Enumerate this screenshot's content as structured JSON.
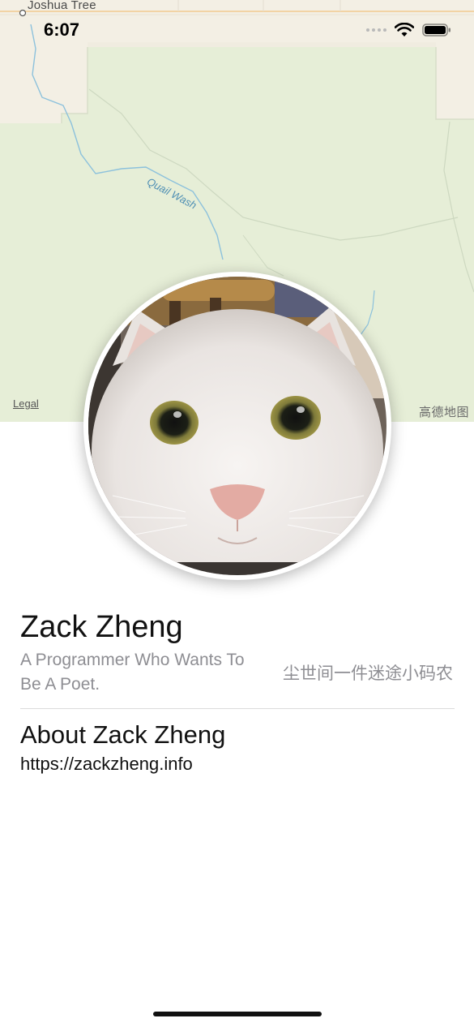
{
  "status_bar": {
    "time": "6:07",
    "icons": [
      "signal-dots-icon",
      "wifi-icon",
      "battery-icon"
    ]
  },
  "map": {
    "place_label": "Joshua Tree",
    "water_label": "Quail Wash",
    "legal_link": "Legal",
    "attribution": "高德地图",
    "colors": {
      "land": "#e6eed7",
      "urban": "#f3efe4",
      "water": "#8cc1dc",
      "boundary": "#cdd8c0",
      "road": "#f2d3a4"
    }
  },
  "profile": {
    "avatar_alt": "cat-photo",
    "name": "Zack Zheng",
    "tagline": "A Programmer Who Wants To Be A Poet.",
    "subtitle_cn": "尘世间一件迷途小码农"
  },
  "about": {
    "title": "About Zack Zheng",
    "link": "https://zackzheng.info"
  }
}
